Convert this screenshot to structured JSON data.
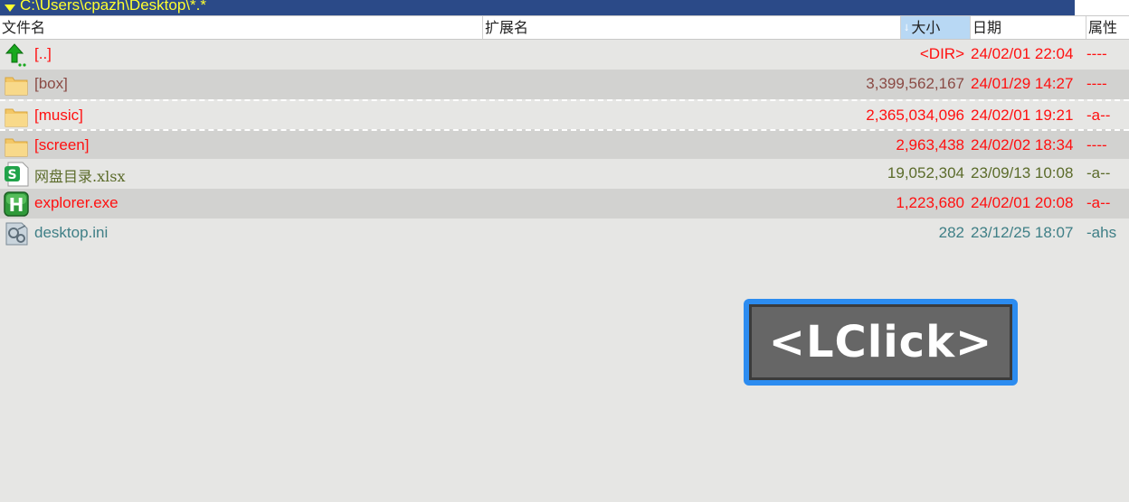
{
  "path": "C:\\Users\\cpazh\\Desktop\\*.*",
  "columns": {
    "name": "文件名",
    "ext": "扩展名",
    "size": "大小",
    "date": "日期",
    "attr": "属性"
  },
  "rows": [
    {
      "icon": "up-dir-icon",
      "name": "[..]",
      "size": "<DIR>",
      "date": "24/02/01 22:04",
      "attr": "----"
    },
    {
      "icon": "folder-icon",
      "name": "[box]",
      "size": "3,399,562,167",
      "date": "24/01/29 14:27",
      "attr": "----"
    },
    {
      "icon": "folder-icon",
      "name": "[music]",
      "size": "2,365,034,096",
      "date": "24/02/01 19:21",
      "attr": "-a--"
    },
    {
      "icon": "folder-icon",
      "name": "[screen]",
      "size": "2,963,438",
      "date": "24/02/02 18:34",
      "attr": "----"
    },
    {
      "icon": "spreadsheet-icon",
      "name": "网盘目录.xlsx",
      "size": "19,052,304",
      "date": "23/09/13 10:08",
      "attr": "-a--"
    },
    {
      "icon": "exe-icon",
      "name": "explorer.exe",
      "size": "1,223,680",
      "date": "24/02/01 20:08",
      "attr": "-a--"
    },
    {
      "icon": "ini-file-icon",
      "name": "desktop.ini",
      "size": "282",
      "date": "23/12/25 18:07",
      "attr": "-ahs"
    }
  ],
  "overlay": {
    "label": "<LClick>"
  },
  "colors": {
    "pathbar": "#2b4a88",
    "path_text": "#ffff2e",
    "sort_header": "#b8d8f4",
    "overlay": "#2c8cf0"
  }
}
